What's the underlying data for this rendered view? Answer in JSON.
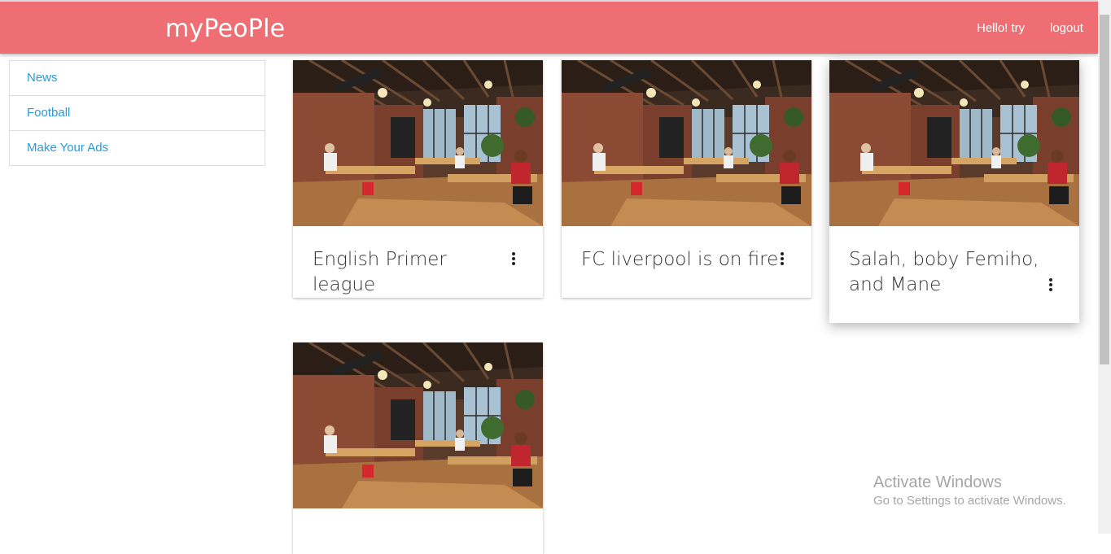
{
  "navbar": {
    "brand": "myPeoPle",
    "greeting": "Hello! try",
    "logout": "logout",
    "color": "#ef6e73"
  },
  "sidebar": {
    "items": [
      {
        "label": "News"
      },
      {
        "label": "Football"
      },
      {
        "label": "Make Your Ads"
      }
    ]
  },
  "cards": [
    {
      "title": "English Primer league",
      "image": "office-photo",
      "menu_icon": "more-vert-icon"
    },
    {
      "title": "FC liverpool is on fire",
      "image": "office-photo",
      "menu_icon": "more-vert-icon"
    },
    {
      "title": "Salah, boby Femiho, and Mane",
      "image": "office-photo",
      "menu_icon": "more-vert-icon"
    },
    {
      "title": "",
      "image": "office-photo",
      "menu_icon": "more-vert-icon"
    }
  ],
  "watermark": {
    "line1": "Activate Windows",
    "line2": "Go to Settings to activate Windows."
  }
}
